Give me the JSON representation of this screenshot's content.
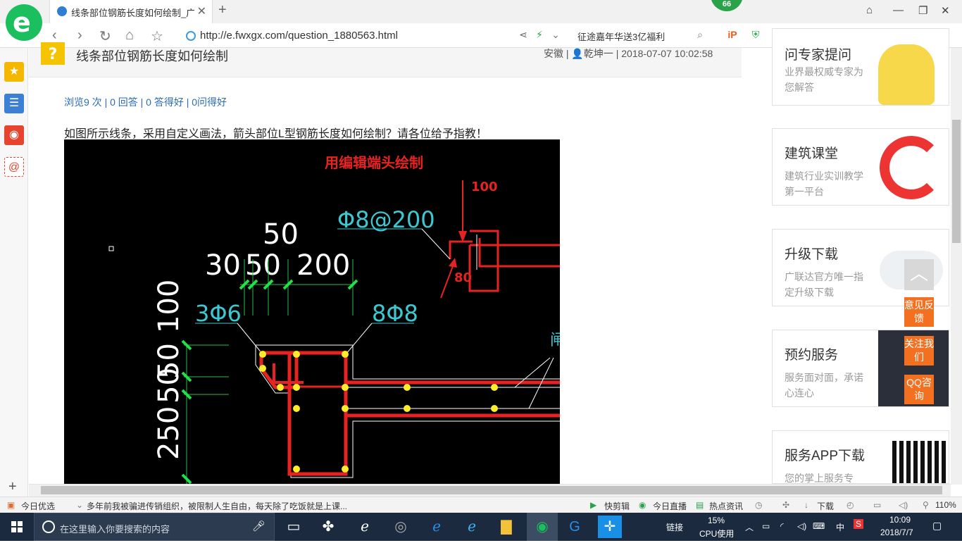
{
  "browser": {
    "tab_title": "线条部位钢筋长度如何绘制_广联",
    "tab_close": "✕",
    "new_tab": "+",
    "badge_count": "66",
    "url": "http://e.fwxgx.com/question_1880563.html",
    "search_text": "征途嘉年华送3亿福利",
    "win_controls": [
      "⌂",
      "—",
      "❐",
      "✕"
    ]
  },
  "question": {
    "icon": "?",
    "title": "线条部位钢筋长度如何绘制",
    "meta": "安徽 | 👤乾坤一 | 2018-07-07 10:02:58",
    "stats": "浏览9 次 | 0 回答 | 0 答得好 | 0问得好",
    "body": "如图所示线条，采用自定义画法，箭头部位L型钢筋长度如何绘制？请各位给予指教！"
  },
  "cad": {
    "red_title": "用编辑端头绘制",
    "label_100_red": "100",
    "label_80_red": "80",
    "rebar_top": "Φ8@200",
    "dim_50_top": "50",
    "dim_30": "30",
    "dim_50": "50",
    "dim_200": "200",
    "rebar_3": "3Φ6",
    "rebar_8": "8Φ8",
    "dim_100_v": "100",
    "dim_50_v1": "50",
    "dim_50_v2": "50",
    "dim_250_v": "250"
  },
  "sidebar_cards": [
    {
      "title": "问专家提问",
      "sub": "业界最权威专家为您解答"
    },
    {
      "title": "建筑课堂",
      "sub": "建筑行业实训教学第一平台"
    },
    {
      "title": "升级下载",
      "sub": "广联达官方唯一指定升级下载"
    },
    {
      "title": "预约服务",
      "sub": "服务面对面，承诺心连心"
    },
    {
      "title": "服务APP下载",
      "sub": "您的掌上服务专"
    }
  ],
  "float_buttons": [
    "意见反馈",
    "关注我们",
    "QQ咨询"
  ],
  "statusbar": {
    "today": "今日优选",
    "news": "多年前我被骗进传销组织，被限制人生自由，每天除了吃饭就是上课...",
    "items": [
      "快剪辑",
      "今日直播",
      "热点资讯",
      "下载"
    ],
    "zoom": "110%"
  },
  "taskbar": {
    "search_placeholder": "在这里输入你要搜索的内容",
    "link": "链接",
    "cpu_percent": "15%",
    "cpu_label": "CPU使用",
    "ime": "中",
    "time": "10:09",
    "date": "2018/7/7"
  },
  "colors": {
    "accent_green": "#1bbf5d",
    "link_blue": "#2b6cb4",
    "float_orange": "#f37021",
    "taskbar": "#1b2a3f"
  }
}
